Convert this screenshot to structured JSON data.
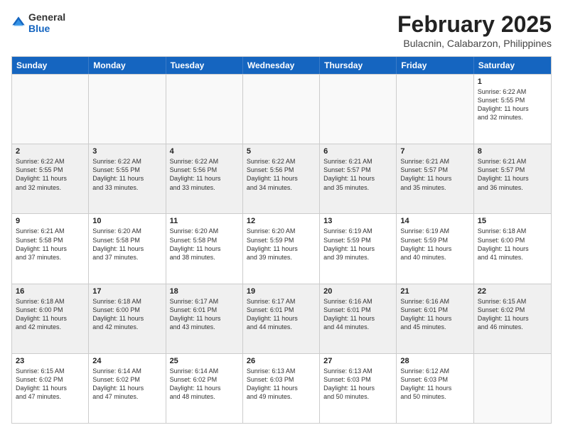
{
  "header": {
    "logo_general": "General",
    "logo_blue": "Blue",
    "month_title": "February 2025",
    "location": "Bulacnin, Calabarzon, Philippines"
  },
  "day_headers": [
    "Sunday",
    "Monday",
    "Tuesday",
    "Wednesday",
    "Thursday",
    "Friday",
    "Saturday"
  ],
  "weeks": [
    {
      "alt": false,
      "days": [
        {
          "num": "",
          "info": ""
        },
        {
          "num": "",
          "info": ""
        },
        {
          "num": "",
          "info": ""
        },
        {
          "num": "",
          "info": ""
        },
        {
          "num": "",
          "info": ""
        },
        {
          "num": "",
          "info": ""
        },
        {
          "num": "1",
          "info": "Sunrise: 6:22 AM\nSunset: 5:55 PM\nDaylight: 11 hours\nand 32 minutes."
        }
      ]
    },
    {
      "alt": true,
      "days": [
        {
          "num": "2",
          "info": "Sunrise: 6:22 AM\nSunset: 5:55 PM\nDaylight: 11 hours\nand 32 minutes."
        },
        {
          "num": "3",
          "info": "Sunrise: 6:22 AM\nSunset: 5:55 PM\nDaylight: 11 hours\nand 33 minutes."
        },
        {
          "num": "4",
          "info": "Sunrise: 6:22 AM\nSunset: 5:56 PM\nDaylight: 11 hours\nand 33 minutes."
        },
        {
          "num": "5",
          "info": "Sunrise: 6:22 AM\nSunset: 5:56 PM\nDaylight: 11 hours\nand 34 minutes."
        },
        {
          "num": "6",
          "info": "Sunrise: 6:21 AM\nSunset: 5:57 PM\nDaylight: 11 hours\nand 35 minutes."
        },
        {
          "num": "7",
          "info": "Sunrise: 6:21 AM\nSunset: 5:57 PM\nDaylight: 11 hours\nand 35 minutes."
        },
        {
          "num": "8",
          "info": "Sunrise: 6:21 AM\nSunset: 5:57 PM\nDaylight: 11 hours\nand 36 minutes."
        }
      ]
    },
    {
      "alt": false,
      "days": [
        {
          "num": "9",
          "info": "Sunrise: 6:21 AM\nSunset: 5:58 PM\nDaylight: 11 hours\nand 37 minutes."
        },
        {
          "num": "10",
          "info": "Sunrise: 6:20 AM\nSunset: 5:58 PM\nDaylight: 11 hours\nand 37 minutes."
        },
        {
          "num": "11",
          "info": "Sunrise: 6:20 AM\nSunset: 5:58 PM\nDaylight: 11 hours\nand 38 minutes."
        },
        {
          "num": "12",
          "info": "Sunrise: 6:20 AM\nSunset: 5:59 PM\nDaylight: 11 hours\nand 39 minutes."
        },
        {
          "num": "13",
          "info": "Sunrise: 6:19 AM\nSunset: 5:59 PM\nDaylight: 11 hours\nand 39 minutes."
        },
        {
          "num": "14",
          "info": "Sunrise: 6:19 AM\nSunset: 5:59 PM\nDaylight: 11 hours\nand 40 minutes."
        },
        {
          "num": "15",
          "info": "Sunrise: 6:18 AM\nSunset: 6:00 PM\nDaylight: 11 hours\nand 41 minutes."
        }
      ]
    },
    {
      "alt": true,
      "days": [
        {
          "num": "16",
          "info": "Sunrise: 6:18 AM\nSunset: 6:00 PM\nDaylight: 11 hours\nand 42 minutes."
        },
        {
          "num": "17",
          "info": "Sunrise: 6:18 AM\nSunset: 6:00 PM\nDaylight: 11 hours\nand 42 minutes."
        },
        {
          "num": "18",
          "info": "Sunrise: 6:17 AM\nSunset: 6:01 PM\nDaylight: 11 hours\nand 43 minutes."
        },
        {
          "num": "19",
          "info": "Sunrise: 6:17 AM\nSunset: 6:01 PM\nDaylight: 11 hours\nand 44 minutes."
        },
        {
          "num": "20",
          "info": "Sunrise: 6:16 AM\nSunset: 6:01 PM\nDaylight: 11 hours\nand 44 minutes."
        },
        {
          "num": "21",
          "info": "Sunrise: 6:16 AM\nSunset: 6:01 PM\nDaylight: 11 hours\nand 45 minutes."
        },
        {
          "num": "22",
          "info": "Sunrise: 6:15 AM\nSunset: 6:02 PM\nDaylight: 11 hours\nand 46 minutes."
        }
      ]
    },
    {
      "alt": false,
      "days": [
        {
          "num": "23",
          "info": "Sunrise: 6:15 AM\nSunset: 6:02 PM\nDaylight: 11 hours\nand 47 minutes."
        },
        {
          "num": "24",
          "info": "Sunrise: 6:14 AM\nSunset: 6:02 PM\nDaylight: 11 hours\nand 47 minutes."
        },
        {
          "num": "25",
          "info": "Sunrise: 6:14 AM\nSunset: 6:02 PM\nDaylight: 11 hours\nand 48 minutes."
        },
        {
          "num": "26",
          "info": "Sunrise: 6:13 AM\nSunset: 6:03 PM\nDaylight: 11 hours\nand 49 minutes."
        },
        {
          "num": "27",
          "info": "Sunrise: 6:13 AM\nSunset: 6:03 PM\nDaylight: 11 hours\nand 50 minutes."
        },
        {
          "num": "28",
          "info": "Sunrise: 6:12 AM\nSunset: 6:03 PM\nDaylight: 11 hours\nand 50 minutes."
        },
        {
          "num": "",
          "info": ""
        }
      ]
    }
  ]
}
